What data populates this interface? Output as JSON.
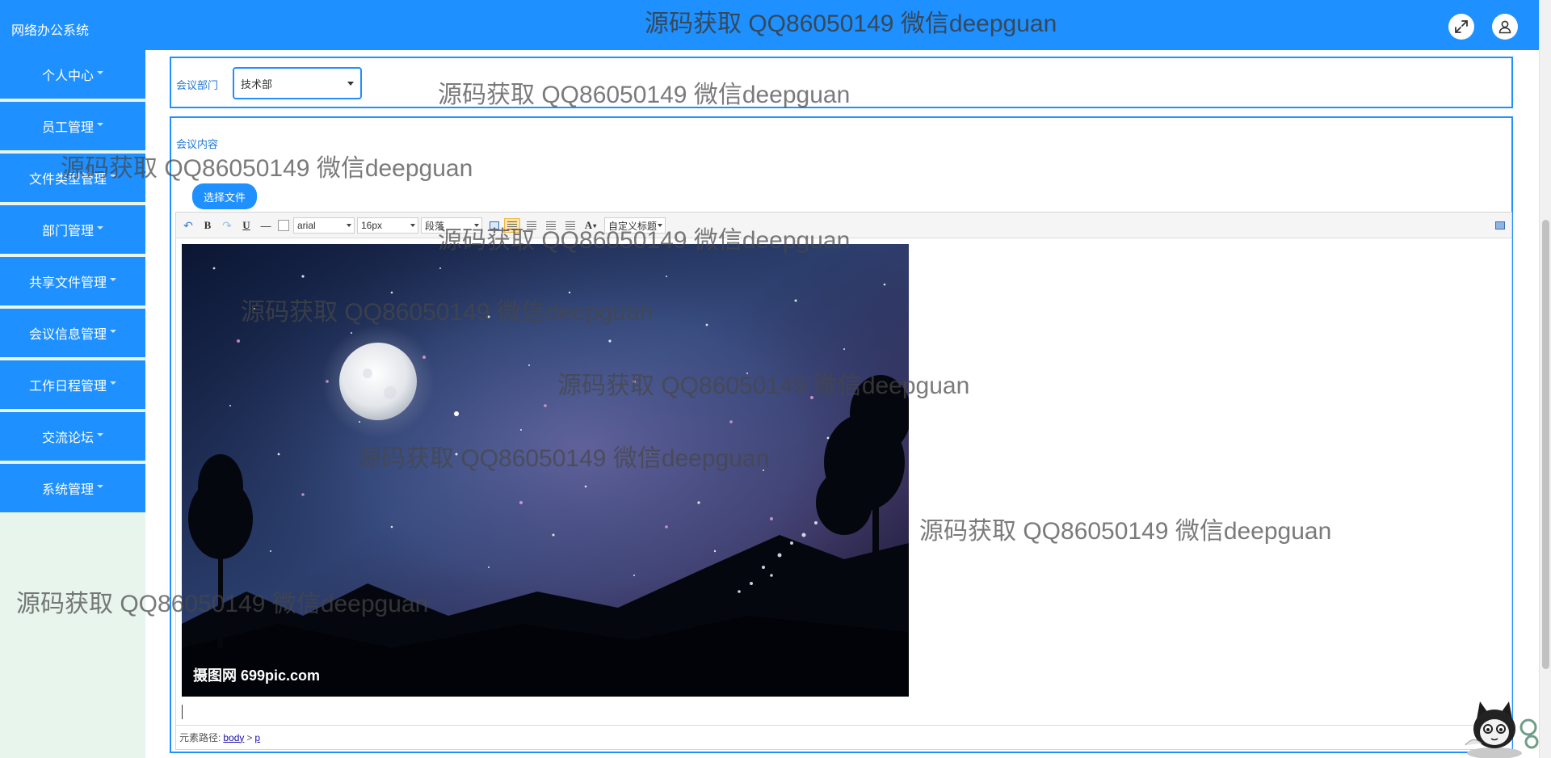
{
  "header": {
    "app_title": "网络办公系统",
    "fullscreen_icon": "expand-arrows-icon",
    "user_icon": "user-icon"
  },
  "sidebar": {
    "items": [
      {
        "label": "个人中心"
      },
      {
        "label": "员工管理"
      },
      {
        "label": "文件类型管理"
      },
      {
        "label": "部门管理"
      },
      {
        "label": "共享文件管理"
      },
      {
        "label": "会议信息管理"
      },
      {
        "label": "工作日程管理"
      },
      {
        "label": "交流论坛"
      },
      {
        "label": "系统管理"
      }
    ]
  },
  "form": {
    "dept_label": "会议部门",
    "dept_value": "技术部",
    "content_label": "会议内容",
    "upload_button": "选择文件"
  },
  "editor": {
    "font_family": "arial",
    "font_size": "16px",
    "paragraph": "段落",
    "custom_title": "自定义标题",
    "image_caption": "摄图网 699pic.com",
    "status_prefix": "元素路径:",
    "path_body": "body",
    "path_sep": ">",
    "path_p": "p"
  },
  "watermark": "源码获取 QQ86050149 微信deepguan",
  "colors": {
    "primary": "#1e90ff",
    "sidebar_bg": "#e8f5ec",
    "label_blue": "#1e78d6"
  }
}
